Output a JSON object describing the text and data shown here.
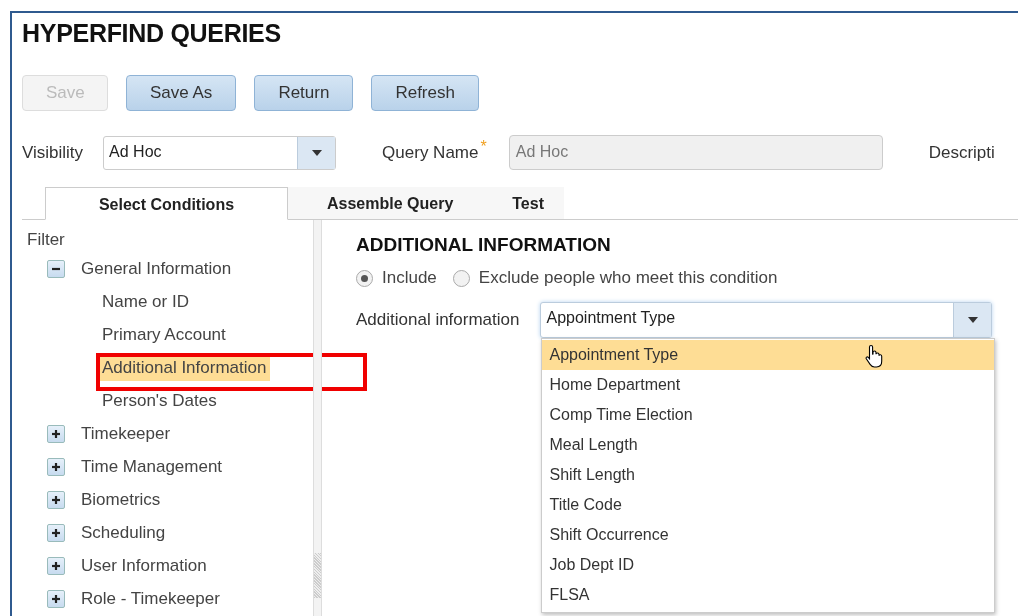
{
  "page": {
    "title": "HYPERFIND QUERIES"
  },
  "buttons": [
    {
      "label": "Save",
      "disabled": true
    },
    {
      "label": "Save As",
      "disabled": false
    },
    {
      "label": "Return",
      "disabled": false
    },
    {
      "label": "Refresh",
      "disabled": false
    }
  ],
  "form": {
    "visibility_label": "Visibility",
    "visibility_value": "Ad Hoc",
    "query_name_label": "Query Name",
    "required_mark": "*",
    "query_name_value": "Ad Hoc",
    "description_label": "Descripti"
  },
  "tabs": [
    {
      "label": "Select Conditions",
      "selected": true
    },
    {
      "label": "Assemble Query",
      "selected": false
    },
    {
      "label": "Test",
      "selected": false
    }
  ],
  "filter": {
    "title": "Filter",
    "items": [
      {
        "label": "General Information",
        "expanded": true,
        "children": [
          {
            "label": "Name or ID",
            "selected": false
          },
          {
            "label": "Primary Account",
            "selected": false
          },
          {
            "label": "Additional Information",
            "selected": true
          },
          {
            "label": "Person's Dates",
            "selected": false
          }
        ]
      },
      {
        "label": "Timekeeper",
        "expanded": false
      },
      {
        "label": "Time Management",
        "expanded": false
      },
      {
        "label": "Biometrics",
        "expanded": false
      },
      {
        "label": "Scheduling",
        "expanded": false
      },
      {
        "label": "User Information",
        "expanded": false
      },
      {
        "label": "Role - Timekeeper",
        "expanded": false
      }
    ]
  },
  "condition": {
    "heading": "ADDITIONAL INFORMATION",
    "radios": [
      {
        "label": "Include",
        "selected": true
      },
      {
        "label": "Exclude people who meet this condition",
        "selected": false
      }
    ],
    "field_label": "Additional information",
    "field_value": "Appointment Type",
    "options": [
      {
        "label": "Appointment Type",
        "selected": true
      },
      {
        "label": "Home Department",
        "selected": false
      },
      {
        "label": "Comp Time Election",
        "selected": false
      },
      {
        "label": "Meal Length",
        "selected": false
      },
      {
        "label": "Shift Length",
        "selected": false
      },
      {
        "label": "Title Code",
        "selected": false
      },
      {
        "label": "Shift Occurrence",
        "selected": false
      },
      {
        "label": "Job Dept ID",
        "selected": false
      },
      {
        "label": "FLSA",
        "selected": false
      }
    ]
  }
}
